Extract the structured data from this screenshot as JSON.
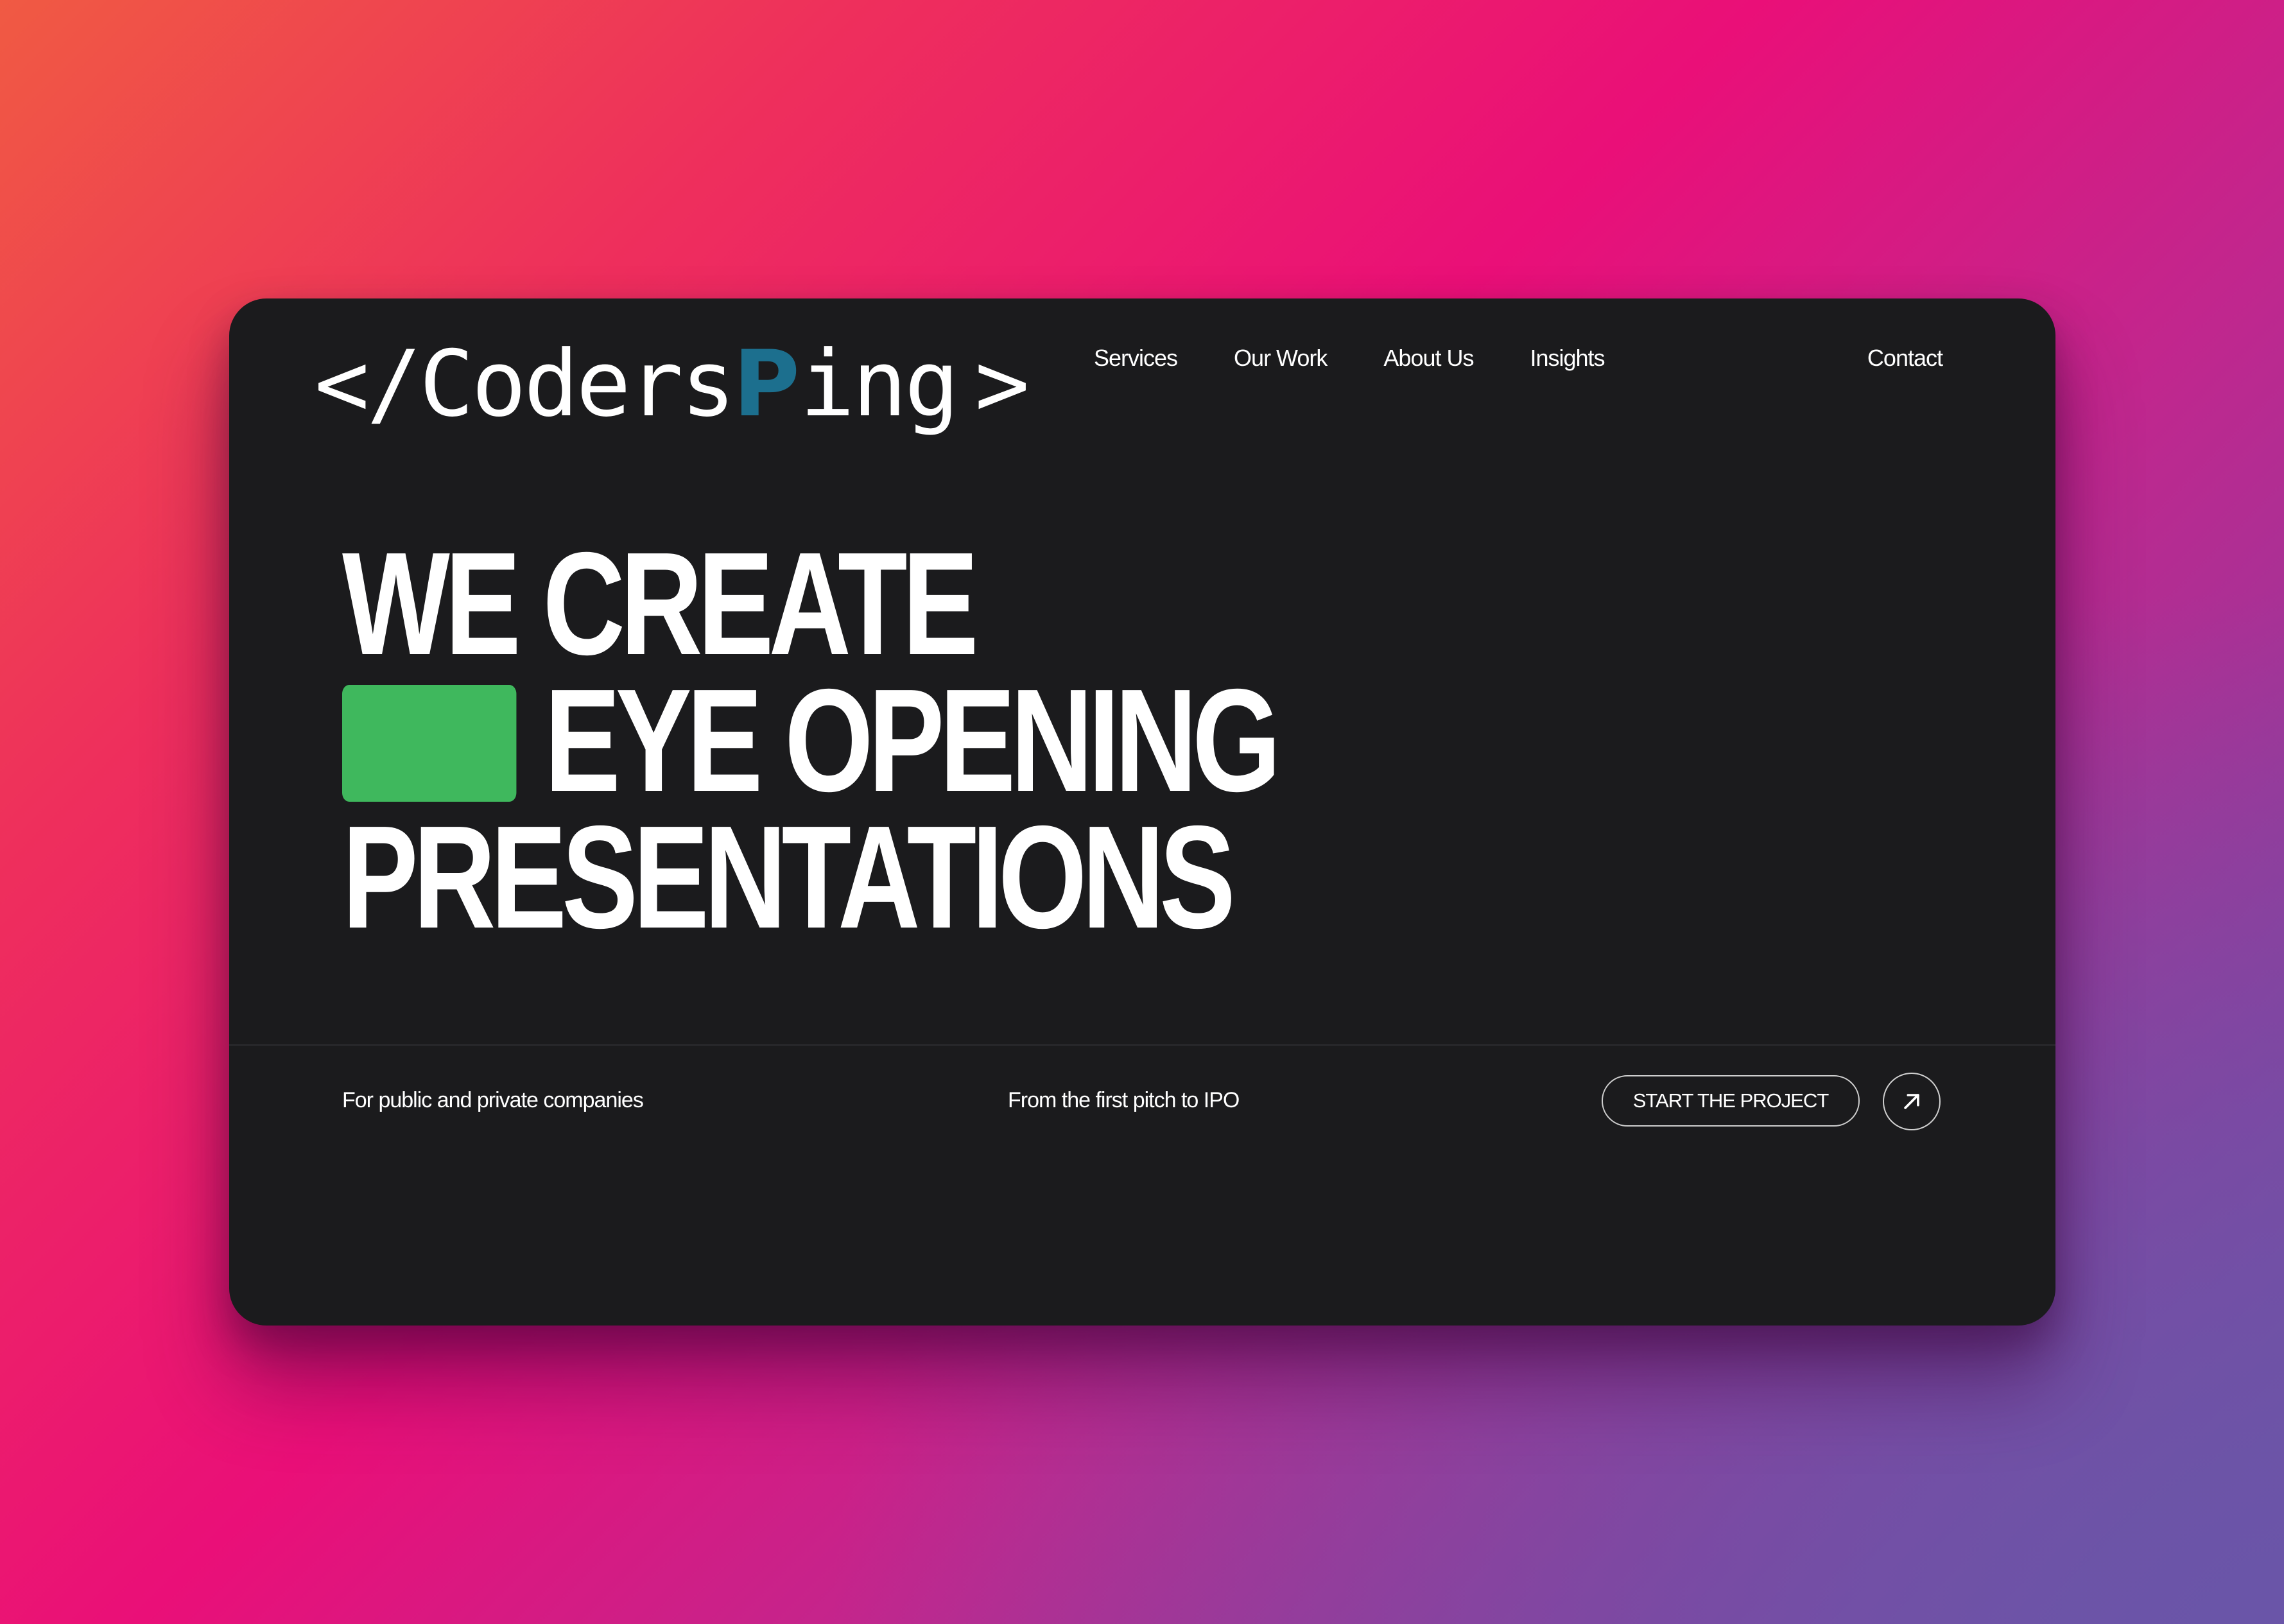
{
  "logo": {
    "open_bracket": "</",
    "word": "Coders",
    "highlight_letter": "P",
    "rest": "ing",
    "close_bracket": ">",
    "highlight_color": "#1c6f8e"
  },
  "nav": {
    "items": [
      {
        "label": "Services"
      },
      {
        "label": "Our Work"
      },
      {
        "label": "About Us"
      },
      {
        "label": "Insights"
      }
    ],
    "contact_label": "Contact"
  },
  "hero": {
    "line1": "WE CREATE",
    "line2": "EYE OPENING",
    "line3": "PRESENTATIONS",
    "accent_color": "#3fb85d"
  },
  "footer": {
    "tagline_left": "For public and private companies",
    "tagline_mid": "From the first pitch to IPO",
    "cta_label": "START THE PROJECT",
    "arrow_icon": "arrow-up-right-icon"
  },
  "colors": {
    "window_background": "#1b1b1d",
    "text": "#ffffff"
  }
}
